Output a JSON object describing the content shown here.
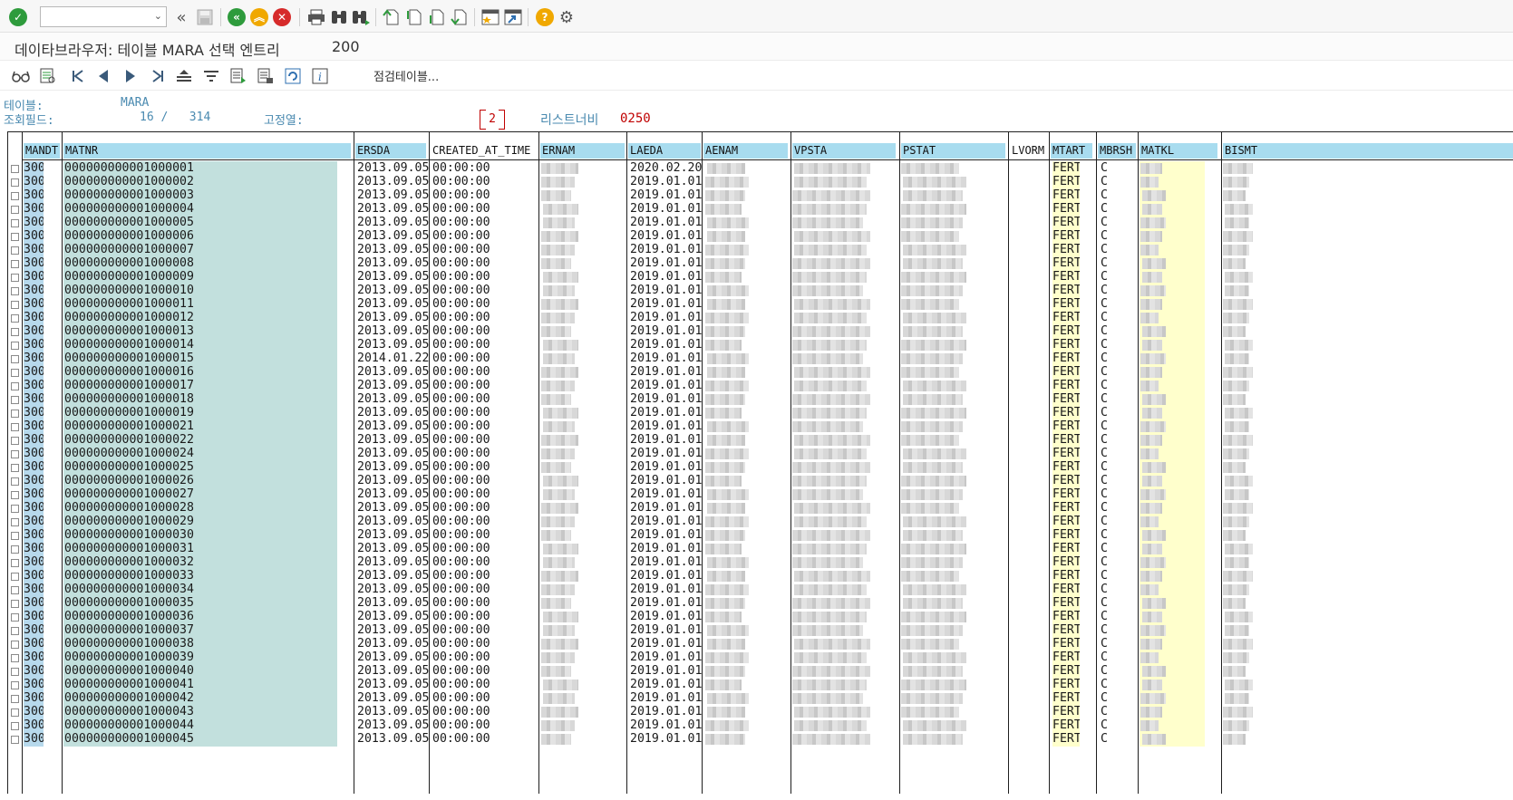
{
  "system_toolbar": {
    "command_field_value": "",
    "icons": [
      "enter-icon",
      "back-icon",
      "exit-icon",
      "cancel-icon",
      "print-icon",
      "find-icon",
      "find-next-icon",
      "first-page-icon",
      "previous-page-icon",
      "next-page-icon",
      "last-page-icon",
      "create-session-icon",
      "shortcut-icon",
      "help-icon",
      "settings-icon"
    ]
  },
  "title": {
    "text": "데이타브라우저: 테이블 MARA 선택 엔트리",
    "count": "200"
  },
  "app_toolbar": {
    "check_tables_label": "점검테이블..."
  },
  "header": {
    "table_label": "테이블:",
    "table_value": "MARA",
    "display_fields_label": "조회필드:",
    "display_fields_value": "16 /   314",
    "fixed_cols_label": "고정열:",
    "fixed_cols_value": "2",
    "list_width_label": "리스트너비",
    "list_width_value": "0250"
  },
  "table": {
    "columns": [
      "MANDT",
      "MATNR",
      "ERSDA",
      "CREATED_AT_TIME",
      "ERNAM",
      "LAEDA",
      "AENAM",
      "VPSTA",
      "PSTAT",
      "LVORM",
      "MTART",
      "MBRSH",
      "MATKL",
      "BISMT"
    ],
    "rows": [
      {
        "mandt": "300",
        "matnr": "000000000001000001",
        "ersda": "2013.09.05",
        "time": "00:00:00",
        "laeda": "2020.02.20",
        "mtart": "FERT",
        "mbrsh": "C"
      },
      {
        "mandt": "300",
        "matnr": "000000000001000002",
        "ersda": "2013.09.05",
        "time": "00:00:00",
        "laeda": "2019.01.01",
        "mtart": "FERT",
        "mbrsh": "C"
      },
      {
        "mandt": "300",
        "matnr": "000000000001000003",
        "ersda": "2013.09.05",
        "time": "00:00:00",
        "laeda": "2019.01.01",
        "mtart": "FERT",
        "mbrsh": "C"
      },
      {
        "mandt": "300",
        "matnr": "000000000001000004",
        "ersda": "2013.09.05",
        "time": "00:00:00",
        "laeda": "2019.01.01",
        "mtart": "FERT",
        "mbrsh": "C"
      },
      {
        "mandt": "300",
        "matnr": "000000000001000005",
        "ersda": "2013.09.05",
        "time": "00:00:00",
        "laeda": "2019.01.01",
        "mtart": "FERT",
        "mbrsh": "C"
      },
      {
        "mandt": "300",
        "matnr": "000000000001000006",
        "ersda": "2013.09.05",
        "time": "00:00:00",
        "laeda": "2019.01.01",
        "mtart": "FERT",
        "mbrsh": "C"
      },
      {
        "mandt": "300",
        "matnr": "000000000001000007",
        "ersda": "2013.09.05",
        "time": "00:00:00",
        "laeda": "2019.01.01",
        "mtart": "FERT",
        "mbrsh": "C"
      },
      {
        "mandt": "300",
        "matnr": "000000000001000008",
        "ersda": "2013.09.05",
        "time": "00:00:00",
        "laeda": "2019.01.01",
        "mtart": "FERT",
        "mbrsh": "C"
      },
      {
        "mandt": "300",
        "matnr": "000000000001000009",
        "ersda": "2013.09.05",
        "time": "00:00:00",
        "laeda": "2019.01.01",
        "mtart": "FERT",
        "mbrsh": "C"
      },
      {
        "mandt": "300",
        "matnr": "000000000001000010",
        "ersda": "2013.09.05",
        "time": "00:00:00",
        "laeda": "2019.01.01",
        "mtart": "FERT",
        "mbrsh": "C"
      },
      {
        "mandt": "300",
        "matnr": "000000000001000011",
        "ersda": "2013.09.05",
        "time": "00:00:00",
        "laeda": "2019.01.01",
        "mtart": "FERT",
        "mbrsh": "C"
      },
      {
        "mandt": "300",
        "matnr": "000000000001000012",
        "ersda": "2013.09.05",
        "time": "00:00:00",
        "laeda": "2019.01.01",
        "mtart": "FERT",
        "mbrsh": "C"
      },
      {
        "mandt": "300",
        "matnr": "000000000001000013",
        "ersda": "2013.09.05",
        "time": "00:00:00",
        "laeda": "2019.01.01",
        "mtart": "FERT",
        "mbrsh": "C"
      },
      {
        "mandt": "300",
        "matnr": "000000000001000014",
        "ersda": "2013.09.05",
        "time": "00:00:00",
        "laeda": "2019.01.01",
        "mtart": "FERT",
        "mbrsh": "C"
      },
      {
        "mandt": "300",
        "matnr": "000000000001000015",
        "ersda": "2014.01.22",
        "time": "00:00:00",
        "laeda": "2019.01.01",
        "mtart": "FERT",
        "mbrsh": "C"
      },
      {
        "mandt": "300",
        "matnr": "000000000001000016",
        "ersda": "2013.09.05",
        "time": "00:00:00",
        "laeda": "2019.01.01",
        "mtart": "FERT",
        "mbrsh": "C"
      },
      {
        "mandt": "300",
        "matnr": "000000000001000017",
        "ersda": "2013.09.05",
        "time": "00:00:00",
        "laeda": "2019.01.01",
        "mtart": "FERT",
        "mbrsh": "C"
      },
      {
        "mandt": "300",
        "matnr": "000000000001000018",
        "ersda": "2013.09.05",
        "time": "00:00:00",
        "laeda": "2019.01.01",
        "mtart": "FERT",
        "mbrsh": "C"
      },
      {
        "mandt": "300",
        "matnr": "000000000001000019",
        "ersda": "2013.09.05",
        "time": "00:00:00",
        "laeda": "2019.01.01",
        "mtart": "FERT",
        "mbrsh": "C"
      },
      {
        "mandt": "300",
        "matnr": "000000000001000021",
        "ersda": "2013.09.05",
        "time": "00:00:00",
        "laeda": "2019.01.01",
        "mtart": "FERT",
        "mbrsh": "C"
      },
      {
        "mandt": "300",
        "matnr": "000000000001000022",
        "ersda": "2013.09.05",
        "time": "00:00:00",
        "laeda": "2019.01.01",
        "mtart": "FERT",
        "mbrsh": "C"
      },
      {
        "mandt": "300",
        "matnr": "000000000001000024",
        "ersda": "2013.09.05",
        "time": "00:00:00",
        "laeda": "2019.01.01",
        "mtart": "FERT",
        "mbrsh": "C"
      },
      {
        "mandt": "300",
        "matnr": "000000000001000025",
        "ersda": "2013.09.05",
        "time": "00:00:00",
        "laeda": "2019.01.01",
        "mtart": "FERT",
        "mbrsh": "C"
      },
      {
        "mandt": "300",
        "matnr": "000000000001000026",
        "ersda": "2013.09.05",
        "time": "00:00:00",
        "laeda": "2019.01.01",
        "mtart": "FERT",
        "mbrsh": "C"
      },
      {
        "mandt": "300",
        "matnr": "000000000001000027",
        "ersda": "2013.09.05",
        "time": "00:00:00",
        "laeda": "2019.01.01",
        "mtart": "FERT",
        "mbrsh": "C"
      },
      {
        "mandt": "300",
        "matnr": "000000000001000028",
        "ersda": "2013.09.05",
        "time": "00:00:00",
        "laeda": "2019.01.01",
        "mtart": "FERT",
        "mbrsh": "C"
      },
      {
        "mandt": "300",
        "matnr": "000000000001000029",
        "ersda": "2013.09.05",
        "time": "00:00:00",
        "laeda": "2019.01.01",
        "mtart": "FERT",
        "mbrsh": "C"
      },
      {
        "mandt": "300",
        "matnr": "000000000001000030",
        "ersda": "2013.09.05",
        "time": "00:00:00",
        "laeda": "2019.01.01",
        "mtart": "FERT",
        "mbrsh": "C"
      },
      {
        "mandt": "300",
        "matnr": "000000000001000031",
        "ersda": "2013.09.05",
        "time": "00:00:00",
        "laeda": "2019.01.01",
        "mtart": "FERT",
        "mbrsh": "C"
      },
      {
        "mandt": "300",
        "matnr": "000000000001000032",
        "ersda": "2013.09.05",
        "time": "00:00:00",
        "laeda": "2019.01.01",
        "mtart": "FERT",
        "mbrsh": "C"
      },
      {
        "mandt": "300",
        "matnr": "000000000001000033",
        "ersda": "2013.09.05",
        "time": "00:00:00",
        "laeda": "2019.01.01",
        "mtart": "FERT",
        "mbrsh": "C"
      },
      {
        "mandt": "300",
        "matnr": "000000000001000034",
        "ersda": "2013.09.05",
        "time": "00:00:00",
        "laeda": "2019.01.01",
        "mtart": "FERT",
        "mbrsh": "C"
      },
      {
        "mandt": "300",
        "matnr": "000000000001000035",
        "ersda": "2013.09.05",
        "time": "00:00:00",
        "laeda": "2019.01.01",
        "mtart": "FERT",
        "mbrsh": "C"
      },
      {
        "mandt": "300",
        "matnr": "000000000001000036",
        "ersda": "2013.09.05",
        "time": "00:00:00",
        "laeda": "2019.01.01",
        "mtart": "FERT",
        "mbrsh": "C"
      },
      {
        "mandt": "300",
        "matnr": "000000000001000037",
        "ersda": "2013.09.05",
        "time": "00:00:00",
        "laeda": "2019.01.01",
        "mtart": "FERT",
        "mbrsh": "C"
      },
      {
        "mandt": "300",
        "matnr": "000000000001000038",
        "ersda": "2013.09.05",
        "time": "00:00:00",
        "laeda": "2019.01.01",
        "mtart": "FERT",
        "mbrsh": "C"
      },
      {
        "mandt": "300",
        "matnr": "000000000001000039",
        "ersda": "2013.09.05",
        "time": "00:00:00",
        "laeda": "2019.01.01",
        "mtart": "FERT",
        "mbrsh": "C"
      },
      {
        "mandt": "300",
        "matnr": "000000000001000040",
        "ersda": "2013.09.05",
        "time": "00:00:00",
        "laeda": "2019.01.01",
        "mtart": "FERT",
        "mbrsh": "C"
      },
      {
        "mandt": "300",
        "matnr": "000000000001000041",
        "ersda": "2013.09.05",
        "time": "00:00:00",
        "laeda": "2019.01.01",
        "mtart": "FERT",
        "mbrsh": "C"
      },
      {
        "mandt": "300",
        "matnr": "000000000001000042",
        "ersda": "2013.09.05",
        "time": "00:00:00",
        "laeda": "2019.01.01",
        "mtart": "FERT",
        "mbrsh": "C"
      },
      {
        "mandt": "300",
        "matnr": "000000000001000043",
        "ersda": "2013.09.05",
        "time": "00:00:00",
        "laeda": "2019.01.01",
        "mtart": "FERT",
        "mbrsh": "C"
      },
      {
        "mandt": "300",
        "matnr": "000000000001000044",
        "ersda": "2013.09.05",
        "time": "00:00:00",
        "laeda": "2019.01.01",
        "mtart": "FERT",
        "mbrsh": "C"
      },
      {
        "mandt": "300",
        "matnr": "000000000001000045",
        "ersda": "2013.09.05",
        "time": "00:00:00",
        "laeda": "2019.01.01",
        "mtart": "FERT",
        "mbrsh": "C"
      }
    ]
  },
  "colors": {
    "mandt_bg": "#b7d9ec",
    "matnr_bg": "#c2e0dd",
    "matkl_bg": "#ffffcc",
    "header_bg": "#a8dcef",
    "label_blue": "#4a8ab0",
    "highlight_red": "#c00000"
  }
}
